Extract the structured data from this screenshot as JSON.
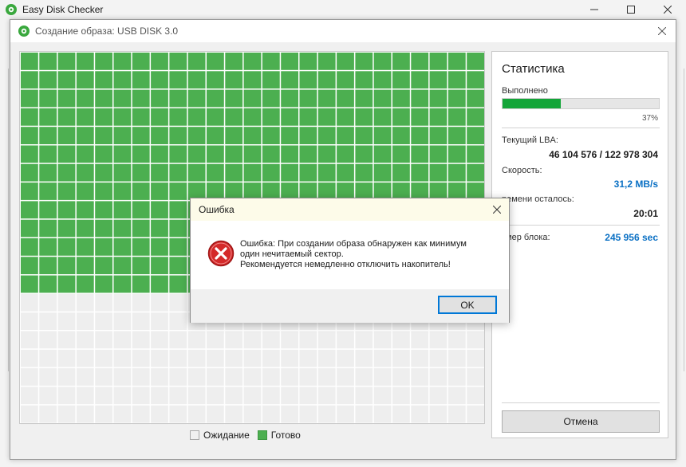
{
  "app": {
    "title": "Easy Disk Checker"
  },
  "dialog": {
    "title": "Создание образа: USB DISK 3.0"
  },
  "grid": {
    "columns": 25,
    "rows": 21,
    "done_cells": 310,
    "colors": {
      "done": "#4caf50",
      "waiting": "#eeeeee"
    }
  },
  "legend": {
    "waiting_label": "Ожидание",
    "done_label": "Готово"
  },
  "stats": {
    "title": "Статистика",
    "completed_label": "Выполнено",
    "progress_fraction": 0.37,
    "progress_text": "37%",
    "lba_label": "Текущий LBA:",
    "lba_value": "46 104 576 / 122 978 304",
    "speed_label": "Скорость:",
    "speed_value": "31,2 MB/s",
    "remaining_label": "ремени осталось:",
    "remaining_value": "20:01",
    "block_label": "змер блока:",
    "block_value": "245 956 sec",
    "cancel_label": "Отмена"
  },
  "error_dialog": {
    "title": "Ошибка",
    "message_line1": "Ошибка: При создании образа обнаружен как минимум",
    "message_line2": "один нечитаемый сектор.",
    "message_line3": "Рекомендуется немедленно отключить накопитель!",
    "ok_label": "OK",
    "icon": "error-icon"
  },
  "colors": {
    "accent_green": "#13a538",
    "link_blue": "#0a70c4",
    "error_red": "#d42a2a"
  }
}
